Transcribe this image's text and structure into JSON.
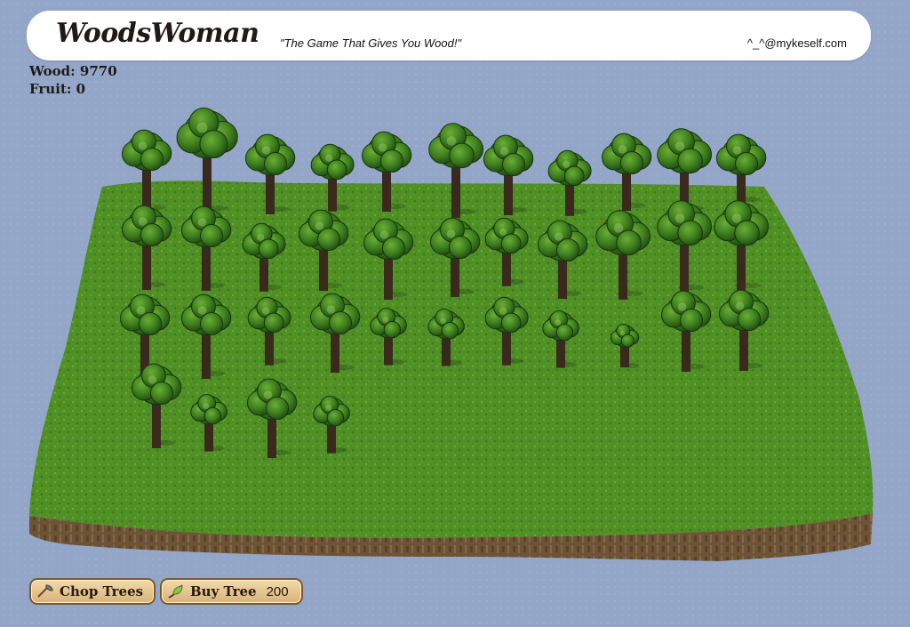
{
  "header": {
    "logo": "WoodsWoman",
    "tagline": "\"The Game That Gives You Wood!\"",
    "credit": "^_^@mykeself.com"
  },
  "counters": {
    "wood": "Wood: 9770",
    "fruit": "Fruit: 0"
  },
  "actions": {
    "chop_label": "Chop Trees",
    "buy_label": "Buy Tree",
    "buy_price": "200"
  },
  "game": {
    "tree_count": 37,
    "grass_color": "#4f8f24",
    "grass_light": "#6aa53a",
    "dirt_color": "#6e5436",
    "canopy_color": "#2f6a1a",
    "trunk_color": "#3a2a1d"
  },
  "icons": {
    "chop_icon": "axe-icon",
    "buy_icon": "seed-leaf-icon"
  }
}
